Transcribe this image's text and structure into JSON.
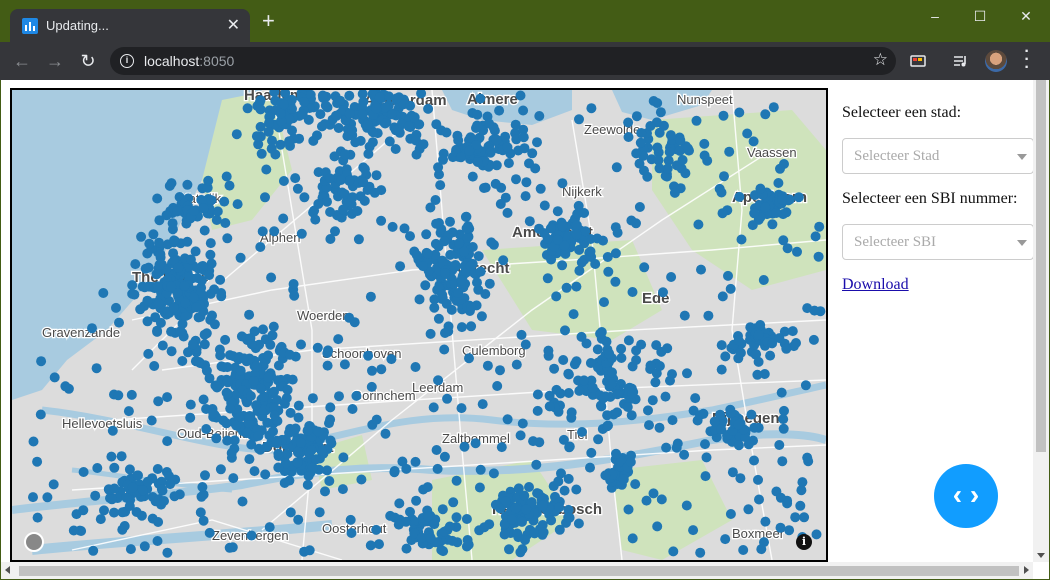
{
  "browser": {
    "tab_title": "Updating...",
    "tab_close": "✕",
    "new_tab": "+",
    "window_controls": {
      "minimize": "–",
      "maximize": "☐",
      "close": "✕"
    },
    "url_host": "localhost",
    "url_port": ":8050",
    "icons": [
      "back-icon",
      "forward-icon",
      "reload-icon",
      "info-icon",
      "star-icon",
      "cast-icon",
      "media-icon",
      "avatar",
      "menu-icon"
    ]
  },
  "map": {
    "marker_color": "#1f77b4",
    "places": [
      "Haarlem",
      "Amsterdam",
      "Almere",
      "Nunspeet",
      "Zeewolde",
      "Vaassen",
      "Apeldoorn",
      "Katwijk",
      "Alphen",
      "Amersfoort",
      "Nijkerk",
      "The Hague",
      "Woerden",
      "Utrecht",
      "Ede",
      "Gravenzande",
      "Schoonhoven",
      "Culemborg",
      "Hellevoetsluis",
      "Oud-Beijerland",
      "Dordrecht",
      "Leerdam",
      "Gorinchem",
      "Zaltbommel",
      "Tiel",
      "Nijmegen",
      "Hertogenbosch",
      "Zevenbergen",
      "Oosterhout",
      "Boxmeer"
    ],
    "attribution_icon": "info-icon",
    "logo_icon": "mapbox-logo-icon"
  },
  "sidebar": {
    "city_label": "Selecteer een stad:",
    "city_placeholder": "Selecteer Stad",
    "sbi_label": "Selecteer een SBI nummer:",
    "sbi_placeholder": "Selecteer SBI",
    "download_label": "Download"
  },
  "debug_button": {
    "label": "‹ ›",
    "color": "#119dff"
  }
}
